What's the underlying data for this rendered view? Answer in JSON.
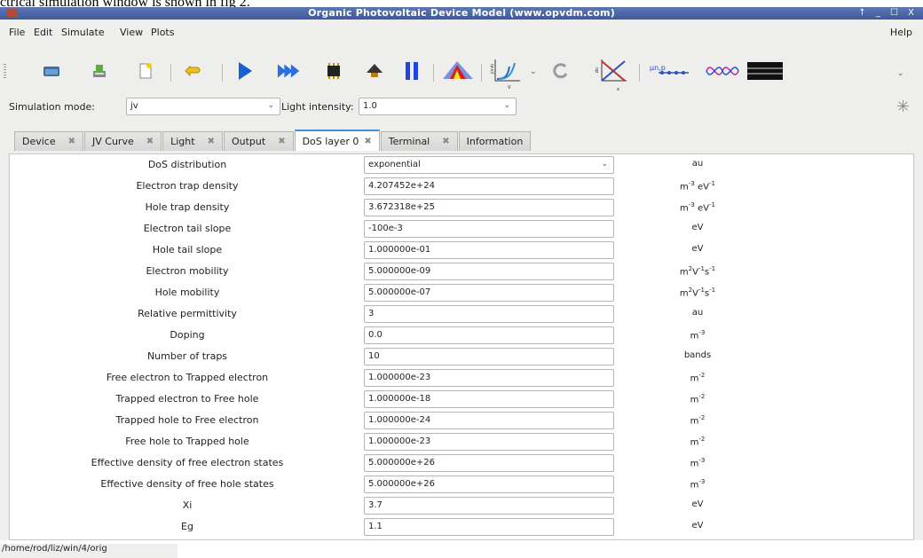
{
  "caption": "ctrical simulation window is shown in fig 2.",
  "window": {
    "title": "Organic Photovoltaic Device Model (www.opvdm.com)",
    "controls": "↑ _ ☐ X"
  },
  "menu": {
    "file": "File",
    "edit": "Edit",
    "simulate": "Simulate",
    "view": "View",
    "plots": "Plots",
    "help": "Help"
  },
  "toolbar": {
    "icons": [
      "open-folder-icon",
      "export-icon",
      "new-file-icon",
      "undo-icon",
      "run-icon",
      "run-scan-icon",
      "chip-icon",
      "stop-icon",
      "3d-plot-icon",
      "jv-plot-icon",
      "refresh-icon",
      "band-diagram-icon",
      "mobility-icon",
      "optics-wave-icon",
      "contacts-icon"
    ],
    "jv_axis_y": "J(mA)",
    "jv_axis_x": "V",
    "band_axis_y": "np",
    "band_axis_x": "x",
    "mobility_label": "μn,p"
  },
  "mode": {
    "sim_label": "Simulation mode:",
    "sim_value": "jv",
    "light_label": "Light intensity:",
    "light_value": "1.0"
  },
  "tabs": [
    {
      "label": "Device"
    },
    {
      "label": "JV Curve"
    },
    {
      "label": "Light"
    },
    {
      "label": "Output"
    },
    {
      "label": "DoS layer 0"
    },
    {
      "label": "Terminal"
    },
    {
      "label": "Information"
    }
  ],
  "params": [
    {
      "name": "DoS distribution",
      "value": "exponential",
      "unit": "au"
    },
    {
      "name": "Electron trap density",
      "value": "4.207452e+24",
      "unit": "m-3 eV-1"
    },
    {
      "name": "Hole trap density",
      "value": "3.672318e+25",
      "unit": "m-3 eV-1"
    },
    {
      "name": "Electron tail slope",
      "value": "-100e-3",
      "unit": "eV"
    },
    {
      "name": "Hole tail slope",
      "value": "1.000000e-01",
      "unit": "eV"
    },
    {
      "name": "Electron mobility",
      "value": "5.000000e-09",
      "unit": "m2V-1s-1"
    },
    {
      "name": "Hole mobility",
      "value": "5.000000e-07",
      "unit": "m2V-1s-1"
    },
    {
      "name": "Relative permittivity",
      "value": "3",
      "unit": "au"
    },
    {
      "name": "Doping",
      "value": "0.0",
      "unit": "m-3"
    },
    {
      "name": "Number of traps",
      "value": "10",
      "unit": "bands"
    },
    {
      "name": "Free electron to Trapped electron",
      "value": "1.000000e-23",
      "unit": "m-2"
    },
    {
      "name": "Trapped electron to Free hole",
      "value": "1.000000e-18",
      "unit": "m-2"
    },
    {
      "name": "Trapped hole to Free electron",
      "value": "1.000000e-24",
      "unit": "m-2"
    },
    {
      "name": "Free hole to Trapped hole",
      "value": "1.000000e-23",
      "unit": "m-2"
    },
    {
      "name": "Effective density of free electron states",
      "value": "5.000000e+26",
      "unit": "m-3"
    },
    {
      "name": "Effective density of free hole states",
      "value": "5.000000e+26",
      "unit": "m-3"
    },
    {
      "name": "Xi",
      "value": "3.7",
      "unit": "eV"
    },
    {
      "name": "Eg",
      "value": "1.1",
      "unit": "eV"
    }
  ],
  "status": {
    "path": "/home/rod/liz/win/4/orig"
  },
  "colors": {
    "titlebar": "#4a67a8",
    "accent_tab": "#4a90d9",
    "window_bg": "#eeeeec"
  }
}
